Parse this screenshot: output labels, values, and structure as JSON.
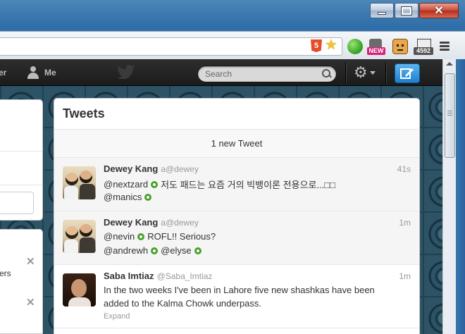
{
  "window": {
    "controls": {
      "minimize": "",
      "maximize": "",
      "close": "✕"
    }
  },
  "browser": {
    "extensions": {
      "new_badge": "NEW",
      "mail_count": "4592"
    }
  },
  "topbar": {
    "nav_partial": "er",
    "me_label": "Me",
    "search_placeholder": "Search"
  },
  "left": {
    "partial_text": "ers"
  },
  "tweets": {
    "header": "Tweets",
    "new_tweet_notice": "1 new Tweet",
    "items": [
      {
        "name": "Dewey Kang",
        "handle": "a@dewey",
        "time": "41s",
        "line1_mention": "@nextzard",
        "line1_text": "저도 패드는 요즘 거의 빅뱅이론 전용으로...□□",
        "line2_mention": "@manics"
      },
      {
        "name": "Dewey Kang",
        "handle": "a@dewey",
        "time": "1m",
        "line1_mention": "@nevin",
        "line1_text": "ROFL!! Serious?",
        "line2_mention": "@andrewh",
        "line2_mention_b": "@elyse"
      },
      {
        "name": "Saba Imtiaz",
        "handle": "@Saba_Imtiaz",
        "time": "1m",
        "line1_text": "In the two weeks I've been in Lahore  five new shashkas have been",
        "line2_text": "added to the Kalma Chowk underpass.",
        "expand": "Expand"
      }
    ]
  },
  "colors": {
    "twitter_topbar": "#1f1f1f",
    "compose_blue": "#2a8ad8",
    "mention_dot_green": "#4aa02c",
    "window_frame_blue": "#2f6ea8"
  }
}
